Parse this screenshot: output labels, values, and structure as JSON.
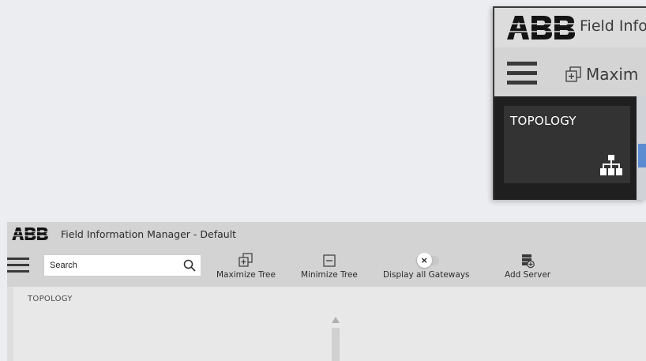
{
  "inset": {
    "title": "Field Info",
    "maximize_label": "Maxim",
    "topology_label": "TOPOLOGY"
  },
  "app": {
    "title": "Field Information Manager - Default",
    "brand_color": "#ff000f"
  },
  "toolbar": {
    "search_placeholder": "Search",
    "maximize_tree": "Maximize Tree",
    "minimize_tree": "Minimize Tree",
    "display_all_gateways": "Display all Gateways",
    "display_all_gateways_toggle": "off",
    "toggle_knob_glyph": "×",
    "add_server": "Add Server"
  },
  "content": {
    "topology_label": "TOPOLOGY"
  },
  "icons": {
    "logo": "abb-logo",
    "menu": "hamburger-menu-icon",
    "search": "search-icon",
    "maximize": "maximize-tree-icon",
    "minimize": "minimize-tree-icon",
    "add_server": "add-server-icon",
    "topology": "topology-tree-icon"
  }
}
